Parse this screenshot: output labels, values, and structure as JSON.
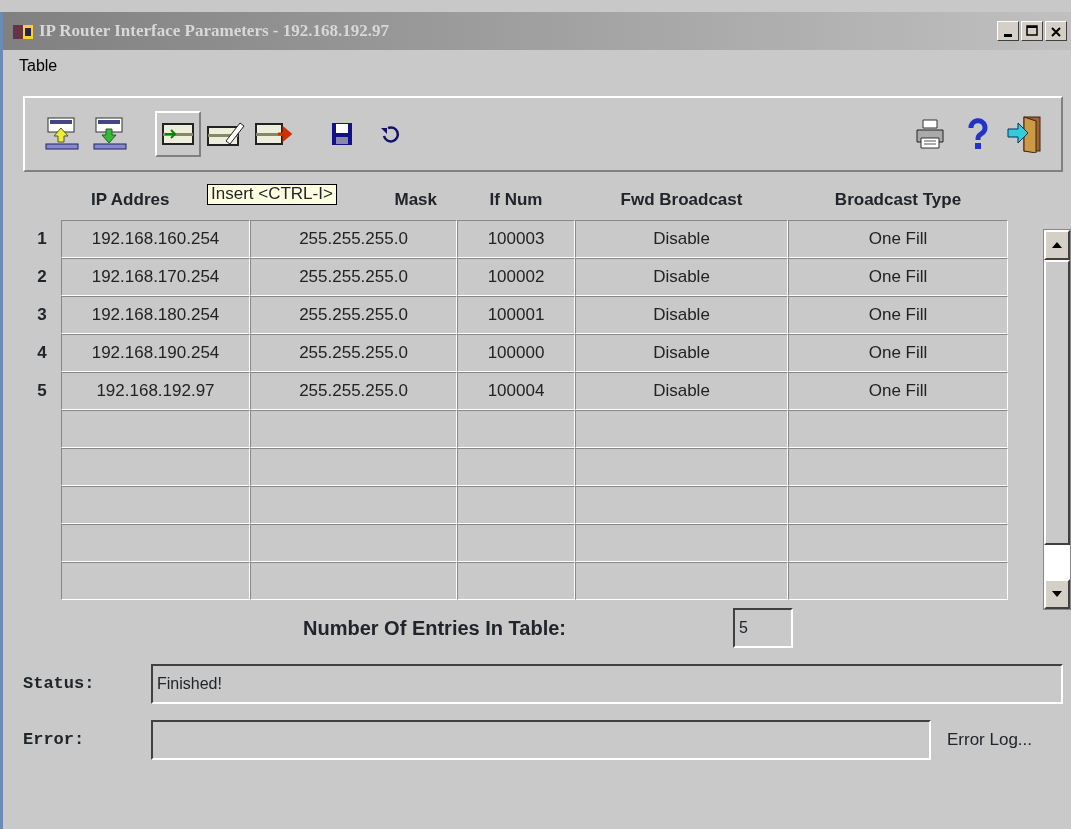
{
  "window": {
    "title": "IP Router Interface Parameters - 192.168.192.97"
  },
  "menu": [
    "Table"
  ],
  "toolbar": [
    {
      "kind": "upload",
      "highlighted": false
    },
    {
      "kind": "download",
      "highlighted": false
    },
    {
      "kind": "insert",
      "highlighted": true
    },
    {
      "kind": "edit",
      "highlighted": false
    },
    {
      "kind": "delete",
      "highlighted": false
    },
    {
      "kind": "save",
      "highlighted": false
    },
    {
      "kind": "undo",
      "highlighted": false
    },
    {
      "kind": "print",
      "highlighted": false
    },
    {
      "kind": "help",
      "highlighted": false
    },
    {
      "kind": "exit",
      "highlighted": false
    }
  ],
  "tooltip": "Insert <CTRL-I>",
  "table": {
    "columns": [
      "IP Addres",
      "Mask",
      "If Num",
      "Fwd Broadcast",
      "Broadcast Type"
    ],
    "rows": [
      {
        "number": "1",
        "cells": [
          "192.168.160.254",
          "255.255.255.0",
          "100003",
          "Disable",
          "One Fill"
        ]
      },
      {
        "number": "2",
        "cells": [
          "192.168.170.254",
          "255.255.255.0",
          "100002",
          "Disable",
          "One Fill"
        ]
      },
      {
        "number": "3",
        "cells": [
          "192.168.180.254",
          "255.255.255.0",
          "100001",
          "Disable",
          "One Fill"
        ]
      },
      {
        "number": "4",
        "cells": [
          "192.168.190.254",
          "255.255.255.0",
          "100000",
          "Disable",
          "One Fill"
        ]
      },
      {
        "number": "5",
        "cells": [
          "192.168.192.97",
          "255.255.255.0",
          "100004",
          "Disable",
          "One Fill"
        ]
      }
    ]
  },
  "entries": {
    "label": "Number Of Entries In Table:",
    "value": "5"
  },
  "status": {
    "label": "Status:",
    "value": "Finished!"
  },
  "error": {
    "label": "Error:",
    "link": "Error Log..."
  }
}
